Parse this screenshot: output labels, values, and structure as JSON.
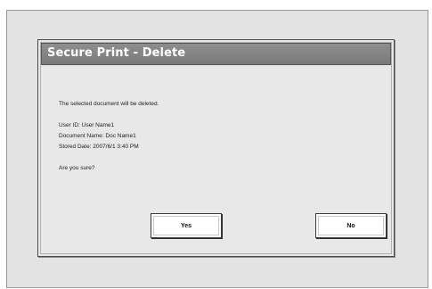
{
  "dialog": {
    "title": "Secure Print - Delete",
    "message": "The selected document will be deleted.",
    "details": {
      "user_id": "User ID: User Name1",
      "document_name": "Document Name: Doc Name1",
      "stored_date": "Stored Date: 2007/6/1 3:40 PM"
    },
    "confirm_question": "Are you sure?",
    "yes_label": "Yes",
    "no_label": "No"
  }
}
